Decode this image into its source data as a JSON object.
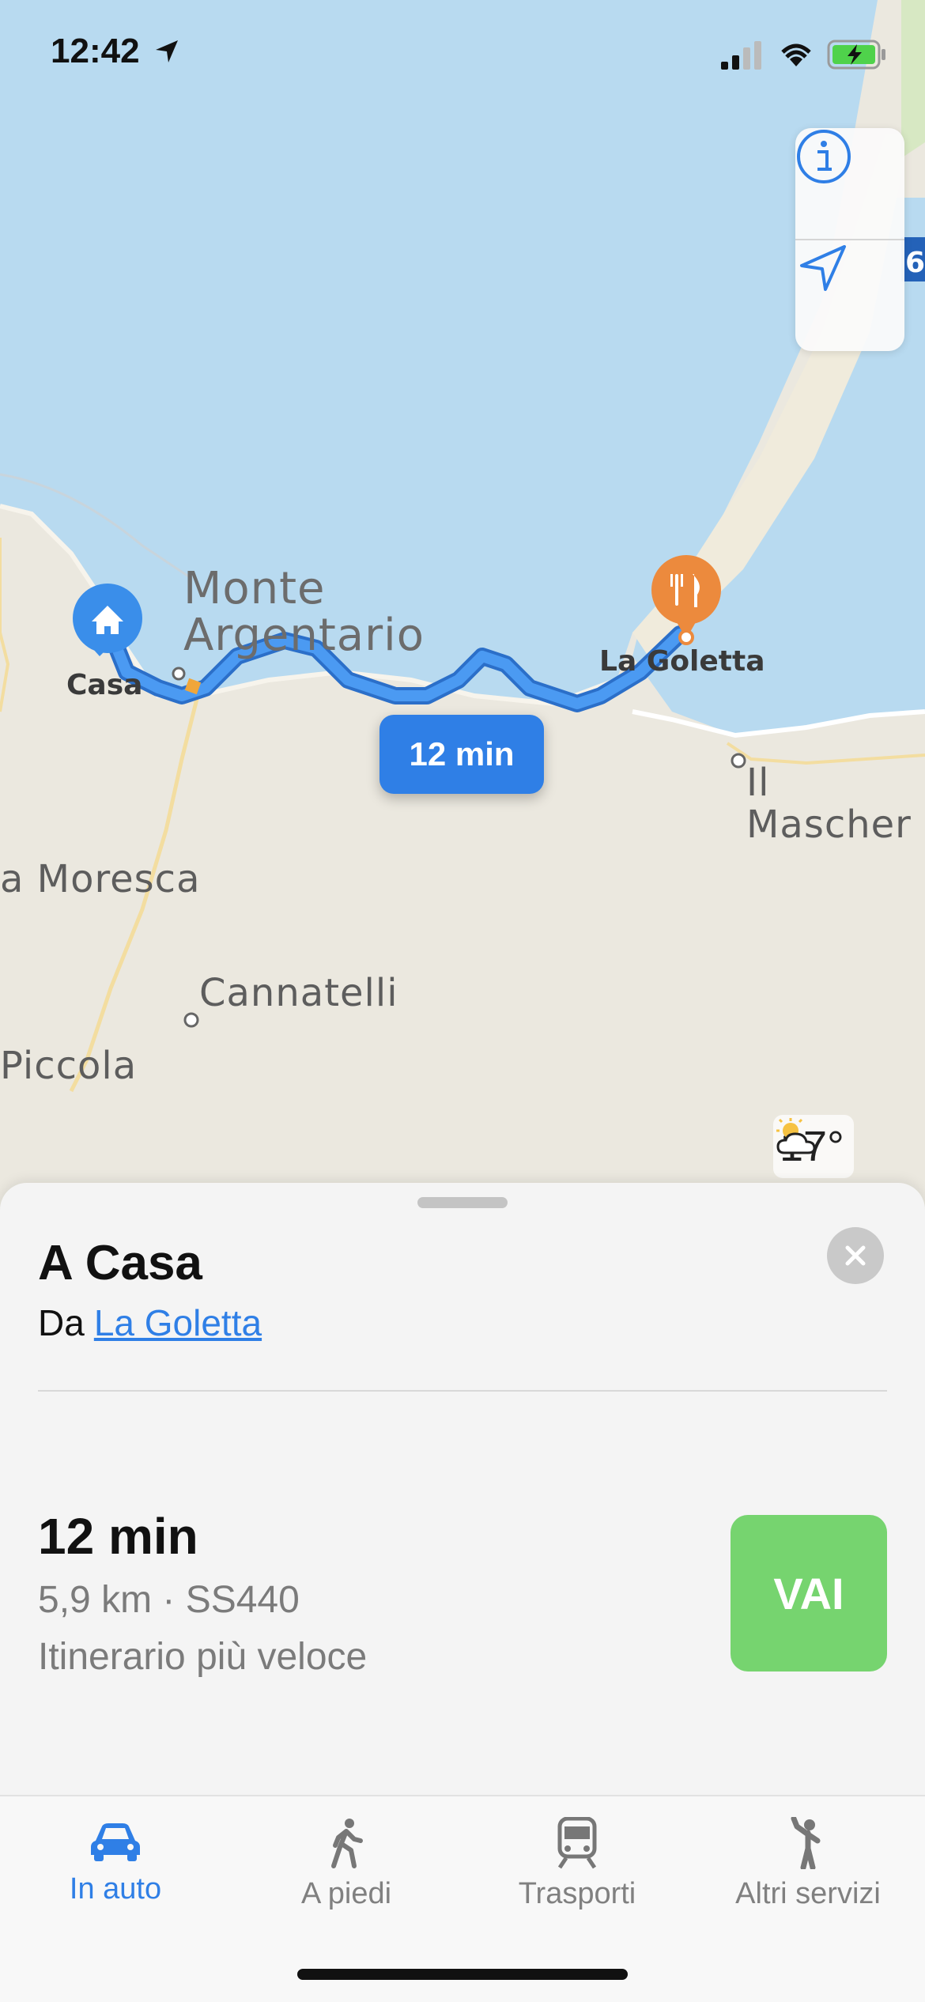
{
  "status_bar": {
    "time": "12:42"
  },
  "map": {
    "labels": {
      "monte_argentario": "Monte\nArgentario",
      "casa": "Casa",
      "la_goletta": "La Goletta",
      "il_maschera": "Il\nMascher",
      "moresca": "a Moresca",
      "cannatelli": "Cannatelli",
      "piccola": "Piccola"
    },
    "route_badge": "12 min",
    "road_shield": "6",
    "weather": {
      "icon": "partly-cloudy-icon",
      "temperature": "17°"
    },
    "controls": {
      "info_icon": "info-icon",
      "location_icon": "location-arrow-icon"
    }
  },
  "sheet": {
    "title": "A Casa",
    "from_prefix": "Da",
    "from_place": "La Goletta",
    "route": {
      "time": "12 min",
      "details": "5,9 km · SS440",
      "description": "Itinerario più veloce",
      "go_label": "VAI"
    }
  },
  "tabs": [
    {
      "label": "In auto",
      "icon": "car-icon",
      "active": true
    },
    {
      "label": "A piedi",
      "icon": "walk-icon",
      "active": false
    },
    {
      "label": "Trasporti",
      "icon": "train-icon",
      "active": false
    },
    {
      "label": "Altri servizi",
      "icon": "rideshare-icon",
      "active": false
    }
  ],
  "colors": {
    "water": "#b8daf0",
    "land": "#ebe8df",
    "route": "#3b86e6",
    "accent": "#2f7fe6",
    "go": "#76d46f",
    "poi_orange": "#ec8a3d"
  }
}
